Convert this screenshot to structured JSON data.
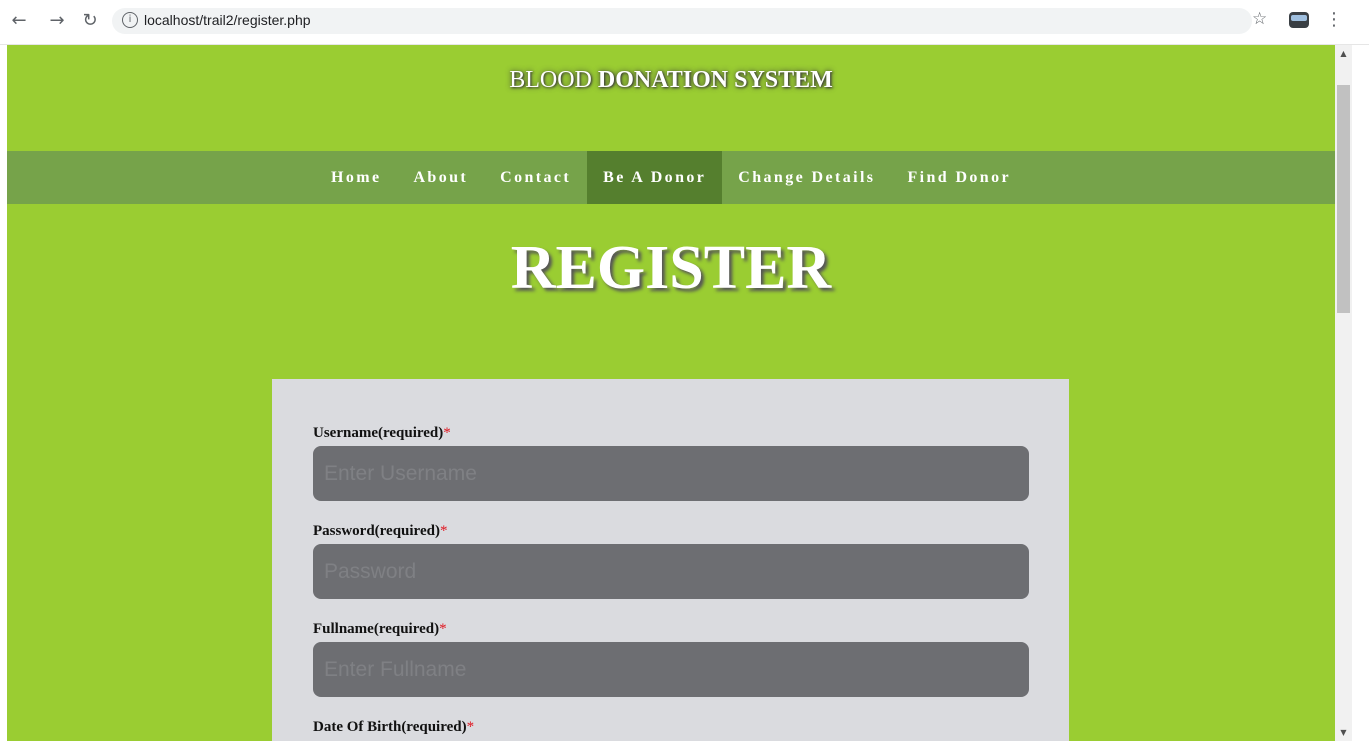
{
  "browser": {
    "url": "localhost/trail2/register.php",
    "back_icon": "←",
    "forward_icon": "→",
    "reload_icon": "↻",
    "info_icon": "i",
    "star_icon": "☆",
    "menu_icon": "⋮"
  },
  "site": {
    "title_normal": "BLOOD ",
    "title_bold": "DONATION SYSTEM"
  },
  "nav": {
    "items": [
      {
        "label": "Home"
      },
      {
        "label": "About"
      },
      {
        "label": "Contact"
      },
      {
        "label": "Be A Donor"
      },
      {
        "label": "Change Details"
      },
      {
        "label": "Find Donor"
      }
    ],
    "active_index": 3
  },
  "page": {
    "heading": "REGISTER"
  },
  "form": {
    "required_marker": "*",
    "username": {
      "label": "Username(required)",
      "placeholder": "Enter Username",
      "value": ""
    },
    "password": {
      "label": "Password(required)",
      "placeholder": "Password",
      "value": ""
    },
    "fullname": {
      "label": "Fullname(required)",
      "placeholder": "Enter Fullname",
      "value": ""
    },
    "dob": {
      "label": "Date Of Birth(required)"
    }
  },
  "scrollbar": {
    "up_icon": "▲",
    "down_icon": "▼"
  },
  "colors": {
    "page_bg": "#9acd32",
    "navbar_bg": "#76a34a",
    "nav_active_bg": "#557f2e",
    "panel_bg": "#dadbdf",
    "input_bg": "#6d6e72",
    "required_color": "#e0141e"
  }
}
